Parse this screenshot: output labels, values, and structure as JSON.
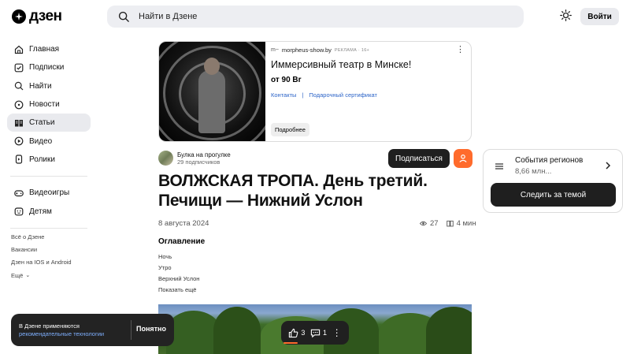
{
  "header": {
    "logo_text": "дзен",
    "search_placeholder": "Найти в Дзене",
    "login_label": "Войти"
  },
  "sidebar": {
    "items": [
      {
        "label": "Главная",
        "icon": "home-icon"
      },
      {
        "label": "Подписки",
        "icon": "subscriptions-icon"
      },
      {
        "label": "Найти",
        "icon": "search-icon"
      },
      {
        "label": "Новости",
        "icon": "news-icon"
      },
      {
        "label": "Статьи",
        "icon": "articles-icon",
        "active": true
      },
      {
        "label": "Видео",
        "icon": "video-icon"
      },
      {
        "label": "Ролики",
        "icon": "shorts-icon"
      }
    ],
    "extra_items": [
      {
        "label": "Видеоигры",
        "icon": "gamepad-icon"
      },
      {
        "label": "Детям",
        "icon": "kids-icon"
      }
    ],
    "footer_links": [
      "Всё о Дзене",
      "Вакансии",
      "Дзен на IOS и Android",
      "Ещё"
    ]
  },
  "ad": {
    "source": "morpheus-show.by",
    "tag": "РЕКЛАМА · 16+",
    "title": "Иммерсивный театр в Минске!",
    "price": "от 90 Br",
    "link1": "Контакты",
    "link_separator": "|",
    "link2": "Подарочный сертификат",
    "button": "Подробнее"
  },
  "channel": {
    "name": "Булка на прогулке",
    "subscribers": "29 подписчиков",
    "subscribe_label": "Подписаться"
  },
  "article": {
    "title": "ВОЛЖСКАЯ ТРОПА. День третий. Печищи — Нижний Услон",
    "date": "8 августа 2024",
    "views": "27",
    "read_time": "4 мин",
    "toc_title": "Оглавление",
    "toc_items": [
      "Ночь",
      "Утро",
      "Верхний Услон"
    ],
    "toc_more": "Показать ещё"
  },
  "actions": {
    "likes": "3",
    "comments": "1"
  },
  "toast": {
    "text": "В Дзене применяются",
    "link": "рекомендательные технологии",
    "button": "Понятно"
  },
  "topic_card": {
    "title": "События регионов",
    "subtitle": "8,66 млн...",
    "button": "Следить за темой"
  },
  "colors": {
    "accent": "#ff6b2c",
    "link": "#2c64c8",
    "dark_button": "#1f1f1f"
  }
}
